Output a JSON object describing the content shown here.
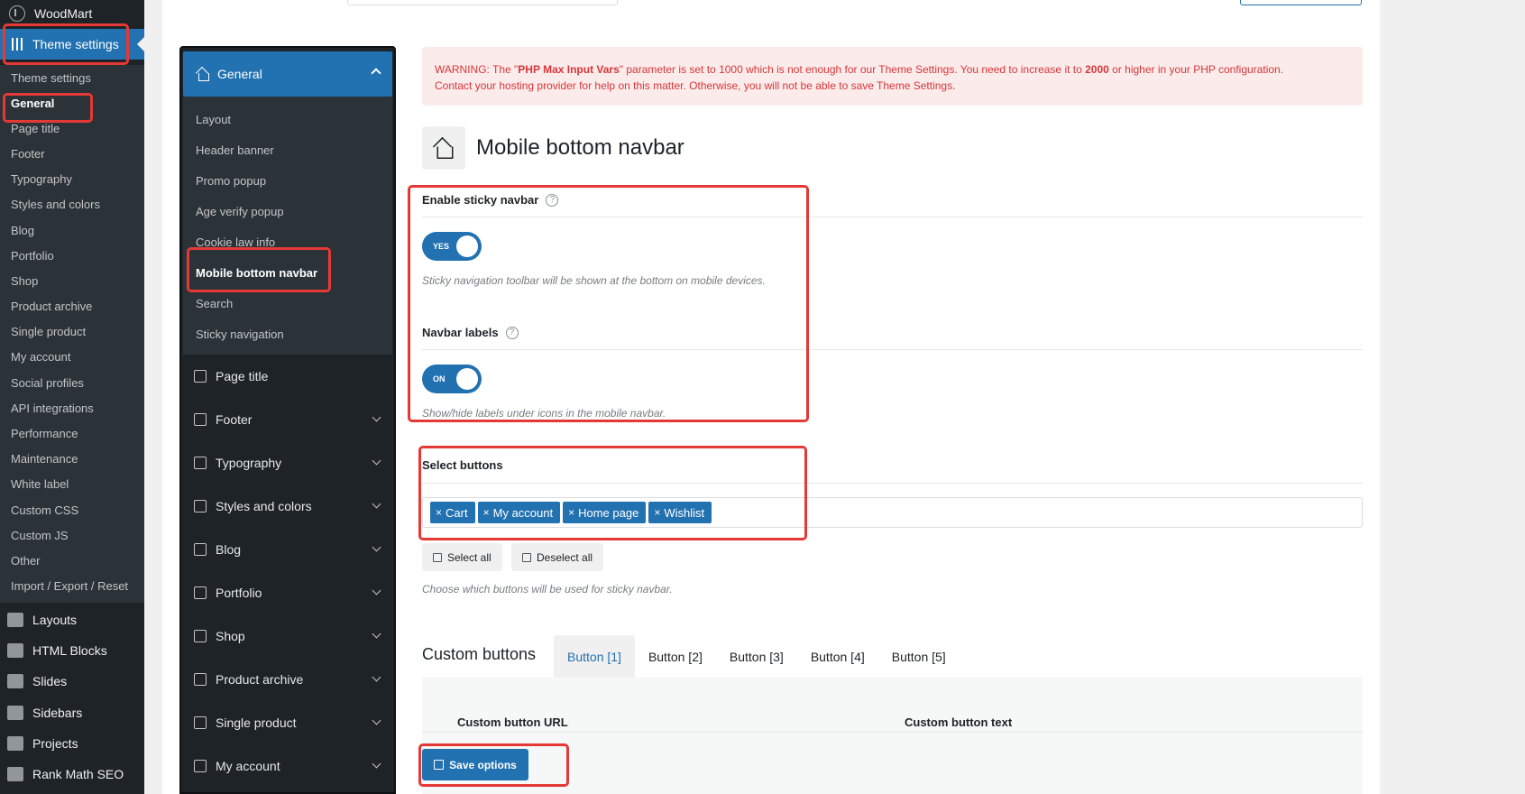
{
  "wp_sidebar": {
    "top_item": "WoodMart",
    "current": "Theme settings",
    "submenu": [
      "Theme settings",
      "General",
      "Page title",
      "Footer",
      "Typography",
      "Styles and colors",
      "Blog",
      "Portfolio",
      "Shop",
      "Product archive",
      "Single product",
      "My account",
      "Social profiles",
      "API integrations",
      "Performance",
      "Maintenance",
      "White label",
      "Custom CSS",
      "Custom JS",
      "Other",
      "Import / Export / Reset"
    ],
    "active_sub": "General",
    "main_items": [
      "Layouts",
      "HTML Blocks",
      "Slides",
      "Sidebars",
      "Projects",
      "Rank Math SEO"
    ]
  },
  "settings_nav": {
    "open_section": "General",
    "subitems": [
      "Layout",
      "Header banner",
      "Promo popup",
      "Age verify popup",
      "Cookie law info",
      "Mobile bottom navbar",
      "Search",
      "Sticky navigation"
    ],
    "active_sub": "Mobile bottom navbar",
    "sections": [
      "Page title",
      "Footer",
      "Typography",
      "Styles and colors",
      "Blog",
      "Portfolio",
      "Shop",
      "Product archive",
      "Single product",
      "My account"
    ]
  },
  "warning": {
    "prefix": "WARNING: The \"",
    "param": "PHP Max Input Vars",
    "mid": "\" parameter is set to 1000 which is not enough for our Theme Settings. You need to increase it to ",
    "value": "2000",
    "suffix": " or higher in your PHP configuration.",
    "line2": "Contact your hosting provider for help on this matter. Otherwise, you will not be able to save Theme Settings."
  },
  "page": {
    "title": "Mobile bottom navbar"
  },
  "fields": {
    "sticky": {
      "title": "Enable sticky navbar",
      "toggle": "YES",
      "desc": "Sticky navigation toolbar will be shown at the bottom on mobile devices."
    },
    "labels": {
      "title": "Navbar labels",
      "toggle": "ON",
      "desc": "Show/hide labels under icons in the mobile navbar."
    },
    "buttons": {
      "title": "Select buttons",
      "tags": [
        "Cart",
        "My account",
        "Home page",
        "Wishlist"
      ],
      "select_all": "Select all",
      "deselect_all": "Deselect all",
      "desc": "Choose which buttons will be used for sticky navbar."
    }
  },
  "custom_buttons": {
    "title": "Custom buttons",
    "tabs": [
      "Button [1]",
      "Button [2]",
      "Button [3]",
      "Button [4]",
      "Button [5]"
    ],
    "active_tab": "Button [1]",
    "url_label": "Custom button URL",
    "text_label": "Custom button text"
  },
  "save_label": "Save options",
  "help_glyph": "?",
  "tag_remove_glyph": "×",
  "colors": {
    "accent": "#2271b1",
    "highlight": "#e53935",
    "warning_bg": "#fcebeb",
    "warning_text": "#d63638"
  }
}
